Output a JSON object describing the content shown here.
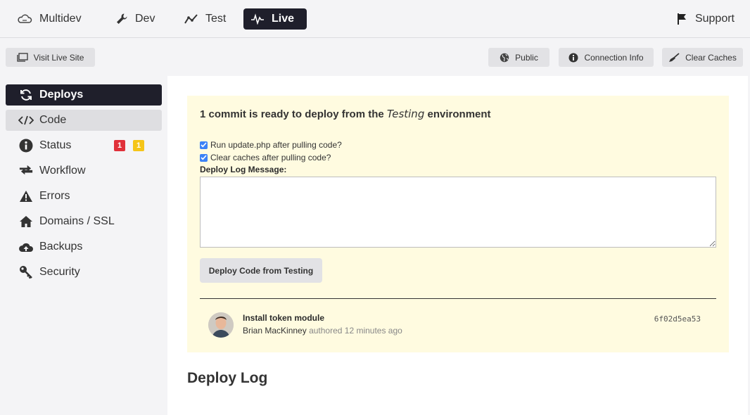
{
  "env_tabs": [
    {
      "label": "Multidev",
      "icon": "cloud-icon"
    },
    {
      "label": "Dev",
      "icon": "wrench-icon"
    },
    {
      "label": "Test",
      "icon": "trend-icon"
    },
    {
      "label": "Live",
      "icon": "pulse-icon",
      "active": true
    }
  ],
  "support": {
    "label": "Support",
    "icon": "flag-icon"
  },
  "toolbar": {
    "visit_live_site": "Visit Live Site",
    "public": "Public",
    "connection_info": "Connection Info",
    "clear_caches": "Clear Caches"
  },
  "sidebar": {
    "items": [
      {
        "label": "Deploys",
        "icon": "sync-icon",
        "active": true
      },
      {
        "label": "Code",
        "icon": "code-icon"
      },
      {
        "label": "Status",
        "icon": "info-icon",
        "badges": [
          "1",
          "1"
        ]
      },
      {
        "label": "Workflow",
        "icon": "exchange-icon"
      },
      {
        "label": "Errors",
        "icon": "warning-icon"
      },
      {
        "label": "Domains / SSL",
        "icon": "home-icon"
      },
      {
        "label": "Backups",
        "icon": "cloud-upload-icon"
      },
      {
        "label": "Security",
        "icon": "key-icon"
      }
    ]
  },
  "deploy_panel": {
    "title_prefix": "1 commit is ready to deploy from the",
    "title_env": "Testing",
    "title_suffix": "environment",
    "checkbox_update": "Run update.php after pulling code?",
    "checkbox_clear": "Clear caches after pulling code?",
    "log_message_label": "Deploy Log Message:",
    "log_message_value": "",
    "deploy_button": "Deploy Code from Testing",
    "commit": {
      "title": "Install token module",
      "author": "Brian MacKinney",
      "meta": "authored 12 minutes ago",
      "hash": "6f02d5ea53"
    }
  },
  "deploy_log_heading": "Deploy Log",
  "colors": {
    "accent_dark": "#1f1f2b",
    "badge_red": "#e0303a",
    "badge_yellow": "#f5c518",
    "panel_bg": "#fffbe0",
    "checkbox_blue": "#3b82f6"
  }
}
